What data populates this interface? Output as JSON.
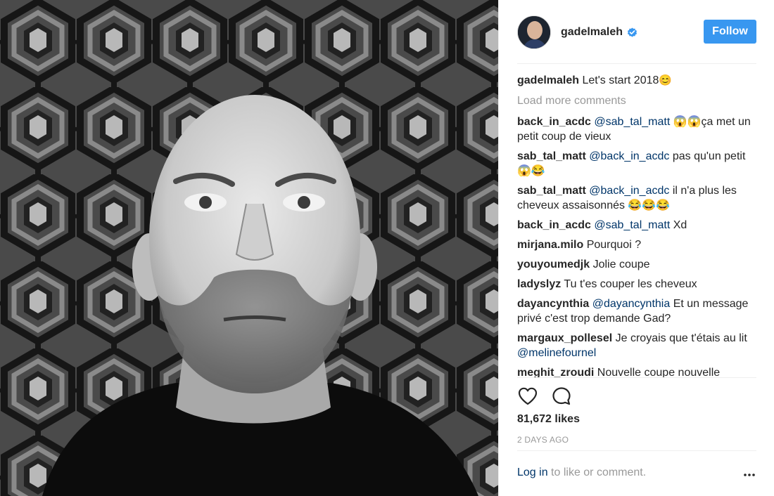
{
  "post": {
    "username": "gadelmaleh",
    "follow_label": "Follow",
    "caption_user": "gadelmaleh",
    "caption_text": "Let's start 2018",
    "caption_emoji": "😊",
    "load_more": "Load more comments",
    "likes": "81,672 likes",
    "time": "2 DAYS AGO",
    "login_link": "Log in",
    "login_suffix": " to like or comment."
  },
  "comments": [
    {
      "user": "back_in_acdc",
      "mention": "@sab_tal_matt",
      "text": " 😱😱ça met un petit coup de vieux"
    },
    {
      "user": "sab_tal_matt",
      "mention": "@back_in_acdc",
      "text": " pas qu'un petit 😱😂"
    },
    {
      "user": "sab_tal_matt",
      "mention": "@back_in_acdc",
      "text": " il n'a plus les cheveux assaisonnés 😂😂😂"
    },
    {
      "user": "back_in_acdc",
      "mention": "@sab_tal_matt",
      "text": " Xd"
    },
    {
      "user": "mirjana.milo",
      "mention": "",
      "text": "Pourquoi ?"
    },
    {
      "user": "youyoumedjk",
      "mention": "",
      "text": "Jolie coupe"
    },
    {
      "user": "ladyslyz",
      "mention": "",
      "text": "Tu t'es couper les cheveux"
    },
    {
      "user": "dayancynthia",
      "mention": "@dayancynthia",
      "text": " Et un message privé c'est trop demande Gad?"
    },
    {
      "user": "margaux_pollesel",
      "mention": "",
      "text": "Je croyais que t'étais au lit "
    },
    {
      "user": "meghit_zroudi",
      "mention": "",
      "text": "Nouvelle coupe nouvelle"
    }
  ],
  "extra_mentions": {
    "margaux": "@melinefournel"
  },
  "icons": {
    "verified": "verified-badge-icon",
    "like": "heart-icon",
    "comment": "comment-bubble-icon",
    "more": "more-options-icon"
  },
  "colors": {
    "accent": "#3897f0",
    "link": "#003569",
    "muted": "#999999"
  }
}
